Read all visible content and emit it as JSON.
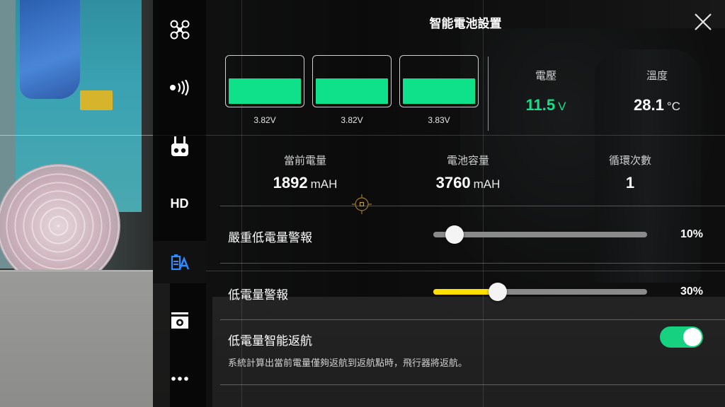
{
  "panel": {
    "title": "智能電池設置"
  },
  "sidebar": {
    "items": [
      {
        "icon": "aircraft-icon"
      },
      {
        "icon": "signal-icon"
      },
      {
        "icon": "remote-controller-icon"
      },
      {
        "icon": "hd-icon",
        "label": "HD"
      },
      {
        "icon": "battery-icon",
        "active": true
      },
      {
        "icon": "camera-icon"
      },
      {
        "icon": "more-icon"
      }
    ]
  },
  "cells": [
    {
      "voltage": "3.82V",
      "level": 0.55
    },
    {
      "voltage": "3.82V",
      "level": 0.55
    },
    {
      "voltage": "3.83V",
      "level": 0.55
    }
  ],
  "voltage": {
    "label": "電壓",
    "value": "11.5",
    "unit": "V"
  },
  "temperature": {
    "label": "溫度",
    "value": "28.1",
    "unit": "°C"
  },
  "stats": {
    "current_charge": {
      "label": "當前電量",
      "value": "1892",
      "unit": "mAH"
    },
    "capacity": {
      "label": "電池容量",
      "value": "3760",
      "unit": "mAH"
    },
    "cycles": {
      "label": "循環次數",
      "value": "1"
    }
  },
  "critical_low_alert": {
    "label": "嚴重低電量警報",
    "value_text": "10%",
    "value": 0.1
  },
  "low_alert": {
    "label": "低電量警報",
    "value_text": "30%",
    "value": 0.3
  },
  "smart_rth": {
    "label": "低電量智能返航",
    "enabled": true,
    "description": "系統計算出當前電量僅夠返航到返航點時，飛行器將返航。"
  },
  "colors": {
    "accent_green": "#16e08b",
    "slider_yellow": "#ffe000",
    "active_blue": "#2f8bff"
  }
}
